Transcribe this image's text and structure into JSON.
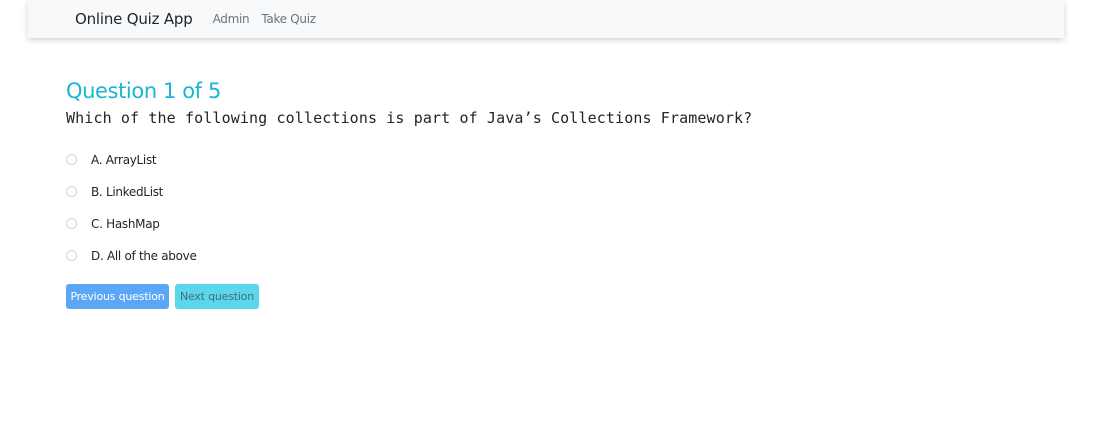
{
  "navbar": {
    "brand": "Online Quiz App",
    "links": [
      "Admin",
      "Take Quiz"
    ]
  },
  "quiz": {
    "title": "Question 1 of 5",
    "question": "Which of the following collections is part of Java’s Collections Framework?",
    "options": [
      "A. ArrayList",
      "B. LinkedList",
      "C. HashMap",
      "D. All of the above"
    ],
    "buttons": {
      "previous": "Previous question",
      "next": "Next question"
    }
  },
  "colors": {
    "title": "#17b6d6",
    "previous_button": "#5ba7f7",
    "next_button": "#5cd6ec",
    "navbar_bg": "#f8f9fa"
  }
}
